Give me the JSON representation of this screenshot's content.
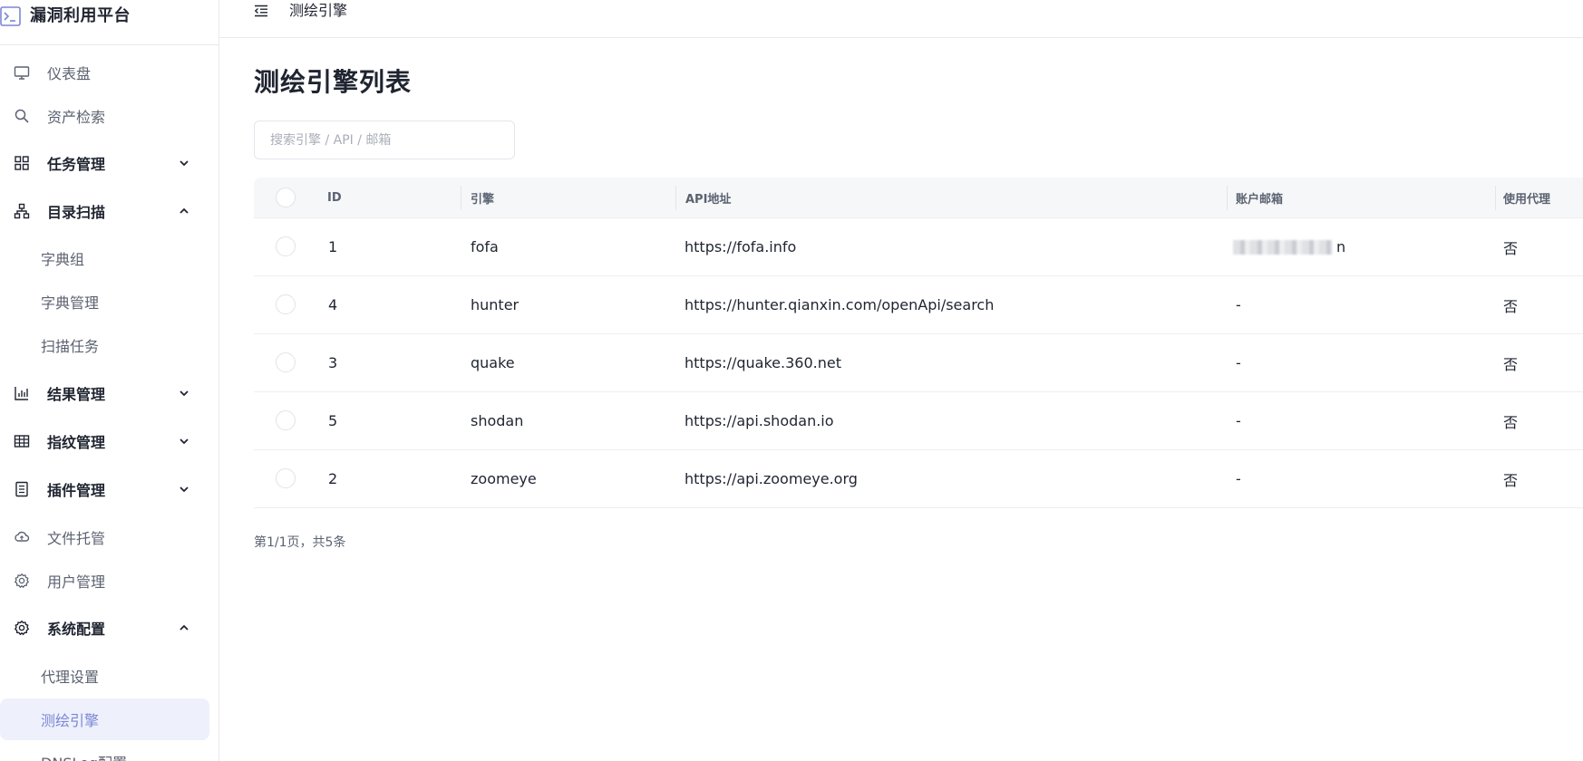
{
  "app": {
    "title": "漏洞利用平台"
  },
  "sidebar": {
    "items": [
      {
        "label": "仪表盘",
        "icon": "monitor-icon"
      },
      {
        "label": "资产检索",
        "icon": "search-icon"
      },
      {
        "label": "任务管理",
        "icon": "grid-icon",
        "expanded": false
      },
      {
        "label": "目录扫描",
        "icon": "sitemap-icon",
        "expanded": true
      },
      {
        "label": "字典组"
      },
      {
        "label": "字典管理"
      },
      {
        "label": "扫描任务"
      },
      {
        "label": "结果管理",
        "icon": "bar-chart-icon",
        "expanded": false
      },
      {
        "label": "指纹管理",
        "icon": "table-icon",
        "expanded": false
      },
      {
        "label": "插件管理",
        "icon": "document-icon",
        "expanded": false
      },
      {
        "label": "文件托管",
        "icon": "cloud-icon"
      },
      {
        "label": "用户管理",
        "icon": "gear-icon"
      },
      {
        "label": "系统配置",
        "icon": "gear-icon",
        "expanded": true
      },
      {
        "label": "代理设置"
      },
      {
        "label": "测绘引擎",
        "active": true
      },
      {
        "label": "DNSLog配置"
      }
    ]
  },
  "header": {
    "breadcrumb": "测绘引擎"
  },
  "main": {
    "title": "测绘引擎列表",
    "search_placeholder": "搜索引擎 / API / 邮箱",
    "columns": [
      "ID",
      "引擎",
      "API地址",
      "账户邮箱",
      "使用代理"
    ],
    "rows": [
      {
        "id": "1",
        "engine": "fofa",
        "api": "https://fofa.info",
        "email": "n",
        "proxy": "否"
      },
      {
        "id": "4",
        "engine": "hunter",
        "api": "https://hunter.qianxin.com/openApi/search",
        "email": "-",
        "proxy": "否"
      },
      {
        "id": "3",
        "engine": "quake",
        "api": "https://quake.360.net",
        "email": "-",
        "proxy": "否"
      },
      {
        "id": "5",
        "engine": "shodan",
        "api": "https://api.shodan.io",
        "email": "-",
        "proxy": "否"
      },
      {
        "id": "2",
        "engine": "zoomeye",
        "api": "https://api.zoomeye.org",
        "email": "-",
        "proxy": "否"
      }
    ],
    "pagination": "第1/1页，共5条"
  },
  "colors": {
    "accent": "#7b86d6",
    "active_bg": "#eef1fb",
    "header_bg": "#f6f7f9",
    "border": "#e8eaee"
  }
}
